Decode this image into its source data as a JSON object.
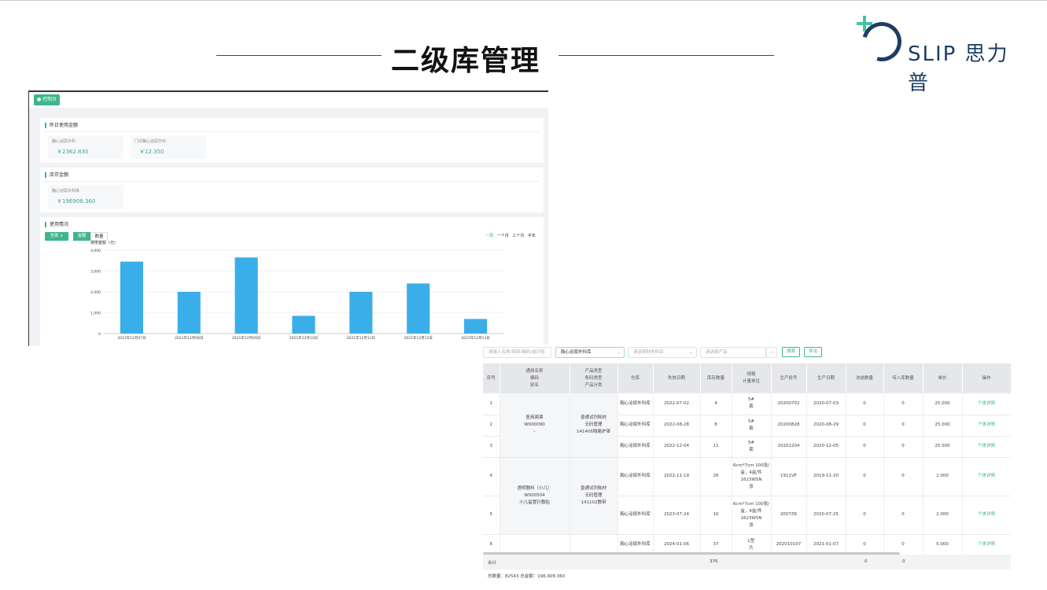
{
  "header": {
    "title": "二级库管理",
    "logo_text": "SLIP 思力普"
  },
  "dashboard": {
    "tab_label": "● 控制台",
    "yesterday": {
      "title": "昨日使用金额",
      "stats": [
        {
          "label": "胸心泌尿外科",
          "value": "￥2362.830"
        },
        {
          "label": "门诊胸心泌尿外科",
          "value": "￥12.350"
        }
      ]
    },
    "inventory": {
      "title": "库存金额",
      "stats": [
        {
          "label": "胸心泌尿外科库",
          "value": "￥196908.360"
        }
      ]
    },
    "usage": {
      "title": "使用情况",
      "filter_label": "全部 ∨",
      "toggle_amount": "金额",
      "toggle_qty": "数量",
      "ranges": [
        "一周",
        "一个月",
        "三个月",
        "半年"
      ],
      "active_range": "一周"
    }
  },
  "chart_data": {
    "type": "bar",
    "ylabel": "使用金额（元）",
    "categories": [
      "2021年12月07日",
      "2021年12月08日",
      "2021年12月09日",
      "2021年12月10日",
      "2021年12月11日",
      "2021年12月12日",
      "2021年12月13日"
    ],
    "values": [
      3450,
      2000,
      3650,
      850,
      2000,
      2400,
      700
    ],
    "ylim": [
      0,
      4000
    ],
    "yticks": [
      "0",
      "1,000",
      "2,000",
      "3,000",
      "4,000"
    ],
    "bar_color": "#3aaee8",
    "grid": true
  },
  "table_view": {
    "filters": {
      "search_placeholder": "请输入名称/简拼/编码/或识别",
      "dept_value": "胸心泌尿外科库",
      "subject_placeholder": "请选择财务科目",
      "product_placeholder": "请选择产品",
      "more": "···",
      "search_btn": "搜索",
      "export_btn": "导出"
    },
    "headers": [
      "序号",
      "通用名称\n编码\n别名",
      "产品类型\n条码类型\n产品分类",
      "仓库",
      "失效日期",
      "库存数量",
      "规格\n计量单位",
      "生产批号",
      "生产日期",
      "冻结数量",
      "待入库数量",
      "单价",
      "操作"
    ],
    "rows": [
      [
        "1",
        "",
        "",
        "胸心泌尿外科库",
        "2022-07-02",
        "4",
        "5#\n套",
        "20200702",
        "2020-07-03",
        "0",
        "0",
        "25.000",
        "个体详情"
      ],
      [
        "2",
        "",
        "",
        "胸心泌尿外科库",
        "2022-08-28",
        "8",
        "5#\n套",
        "20200828",
        "2020-08-29",
        "0",
        "0",
        "25.000",
        "个体详情"
      ],
      [
        "3",
        "",
        "",
        "胸心泌尿外科库",
        "2022-12-04",
        "11",
        "5#\n套",
        "20201204",
        "2020-12-05",
        "0",
        "0",
        "25.000",
        "个体详情"
      ],
      [
        "4",
        "",
        "",
        "胸心泌尿外科库",
        "2022-11-19",
        "26",
        "6cm*7cm 100张/盒，4盒/件 1623WSN\n张",
        "1911VF",
        "2019-11-20",
        "0",
        "0",
        "2.000",
        "个体详情"
      ],
      [
        "5",
        "",
        "",
        "胸心泌尿外科库",
        "2023-07-24",
        "10",
        "6cm*7cm 100张/盒，4盒/件 1623WSN\n张",
        "2007ZK",
        "2020-07-25",
        "0",
        "0",
        "2.000",
        "个体详情"
      ],
      [
        "6",
        "",
        "",
        "胸心泌尿外科库",
        "2024-01-06",
        "37",
        "L型\n片",
        "202010107",
        "2021-01-07",
        "0",
        "0",
        "5.000",
        "个体详情"
      ]
    ],
    "group1": {
      "name": "医用面罩\nW000090\n-",
      "type": "普通试剂耗材\n无码管理\n141406隔离护罩"
    },
    "group2": {
      "name": "透明敷料（小儿）\nW000504\n小儿留置针敷贴",
      "type": "普通试剂耗材\n无码管理\n141102敷带"
    },
    "footer": {
      "label": "合计",
      "stock_total": "376",
      "frozen_total": "0",
      "pending_total": "0"
    },
    "summary": "总数量：82543    总金额：196,908.360"
  }
}
